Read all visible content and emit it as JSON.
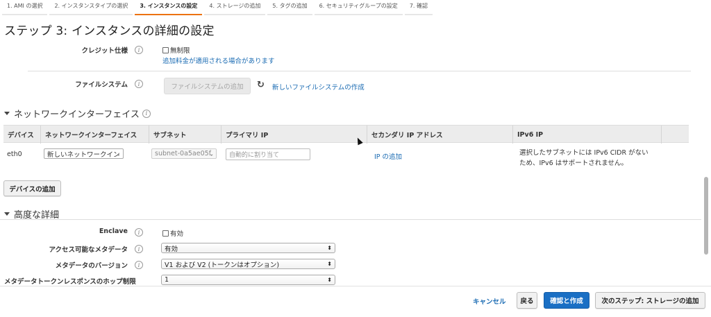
{
  "wizard": {
    "steps": [
      {
        "label": "1. AMI の選択",
        "active": false
      },
      {
        "label": "2. インスタンスタイプの選択",
        "active": false
      },
      {
        "label": "3. インスタンスの設定",
        "active": true
      },
      {
        "label": "4. ストレージの追加",
        "active": false
      },
      {
        "label": "5. タグの追加",
        "active": false
      },
      {
        "label": "6. セキュリティグループの設定",
        "active": false
      },
      {
        "label": "7. 確認",
        "active": false
      }
    ]
  },
  "page": {
    "title": "ステップ 3: インスタンスの詳細の設定"
  },
  "credit": {
    "label": "クレジット仕様",
    "checkbox_label": "無制限",
    "note": "追加料金が適用される場合があります"
  },
  "filesystem": {
    "label": "ファイルシステム",
    "add_button": "ファイルシステムの追加",
    "create_link": "新しいファイルシステムの作成"
  },
  "network": {
    "section_title": "ネットワークインターフェイス",
    "columns": [
      "デバイス",
      "ネットワークインターフェイス",
      "サブネット",
      "プライマリ IP",
      "セカンダリ IP アドレス",
      "IPv6 IP"
    ],
    "row": {
      "device": "eth0",
      "interface": "新しいネットワークイン",
      "subnet": "subnet-0a5ae05f",
      "primary_ip_placeholder": "自動的に割り当て",
      "add_ip_link": "IP の追加",
      "ipv6_note_line1": "選択したサブネットには IPv6 CIDR がない",
      "ipv6_note_line2": "ため、IPv6 はサポートされません。"
    },
    "add_device_button": "デバイスの追加"
  },
  "advanced": {
    "section_title": "高度な詳細",
    "enclave_label": "Enclave",
    "enclave_checkbox": "有効",
    "metadata_access_label": "アクセス可能なメタデータ",
    "metadata_access_value": "有効",
    "metadata_version_label": "メタデータのバージョン",
    "metadata_version_value": "V1 および V2 (トークンはオプション)",
    "hop_limit_label": "メタデータトークンレスポンスのホップ制限",
    "hop_limit_value": "1"
  },
  "footer": {
    "cancel": "キャンセル",
    "back": "戻る",
    "review_launch": "確認と作成",
    "next": "次のステップ: ストレージの追加"
  },
  "colors": {
    "accent_tab": "#ec7211",
    "link": "#1a6bb3",
    "primary_button": "#1a6fc4"
  }
}
